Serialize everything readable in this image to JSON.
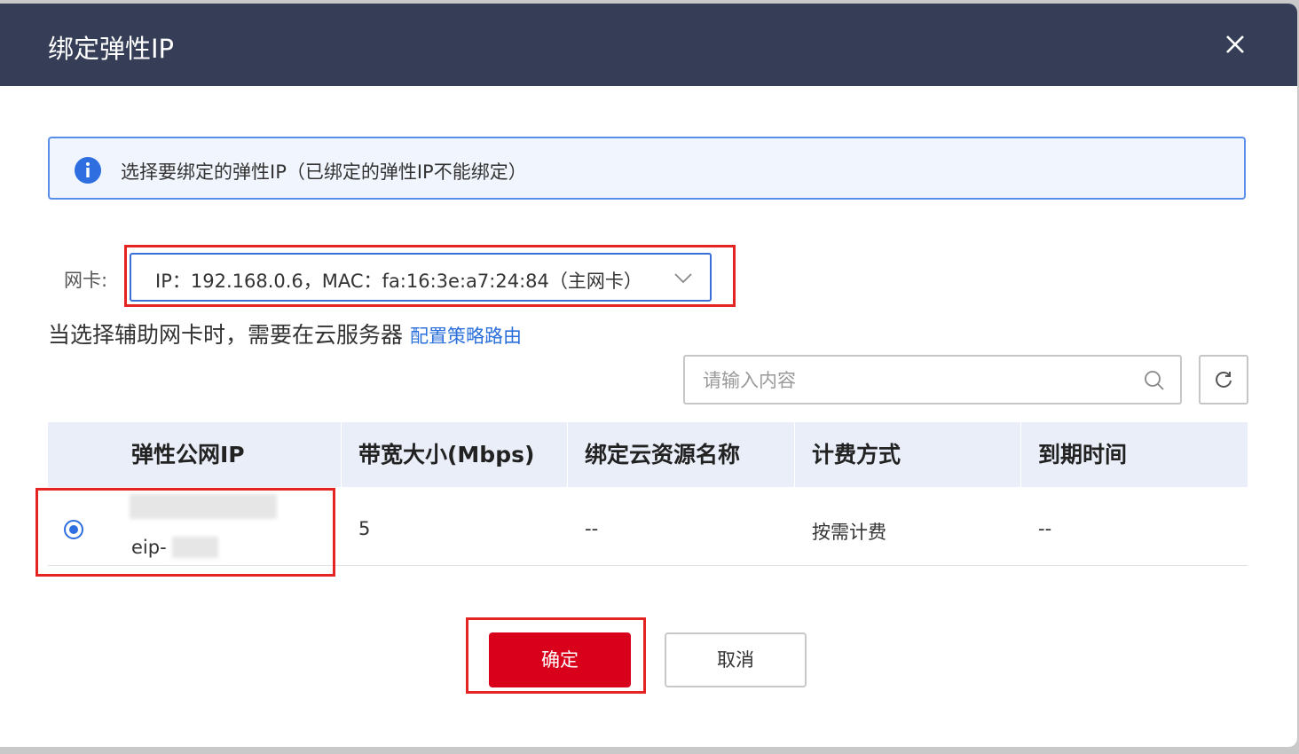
{
  "dialog": {
    "title": "绑定弹性IP",
    "close_icon": "close-icon"
  },
  "info": {
    "icon": "info-icon",
    "text": "选择要绑定的弹性IP（已绑定的弹性IP不能绑定）"
  },
  "nic": {
    "label": "网卡:",
    "selected": "IP：192.168.0.6，MAC：fa:16:3e:a7:24:84（主网卡）"
  },
  "hint": {
    "text": "当选择辅助网卡时，需要在云服务器 ",
    "link": "配置策略路由"
  },
  "search": {
    "placeholder": "请输入内容"
  },
  "table": {
    "columns": [
      "弹性公网IP",
      "带宽大小(Mbps)",
      "绑定云资源名称",
      "计费方式",
      "到期时间"
    ],
    "rows": [
      {
        "selected": true,
        "ip": "",
        "name": "eip-",
        "bandwidth": "5",
        "resource": "--",
        "billing": "按需计费",
        "expire": "--"
      }
    ]
  },
  "buttons": {
    "confirm": "确定",
    "cancel": "取消"
  },
  "colors": {
    "header_bg": "#353e56",
    "primary": "#d9001b",
    "link": "#2a6fdb",
    "highlight_box": "#e42323"
  }
}
